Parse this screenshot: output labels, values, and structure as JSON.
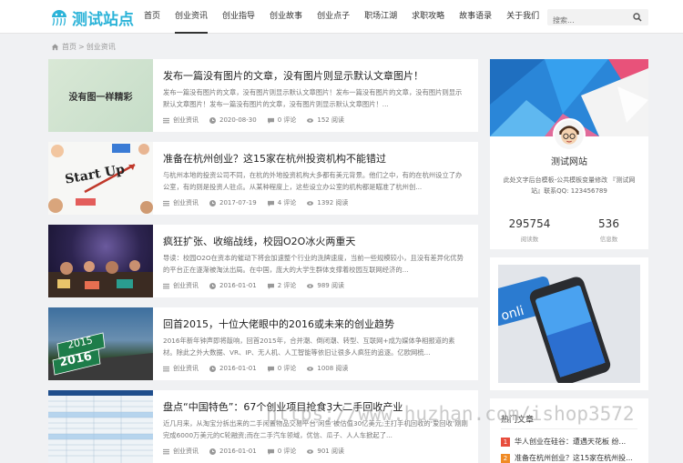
{
  "header": {
    "logo_text": "测试站点",
    "nav": [
      "首页",
      "创业资讯",
      "创业指导",
      "创业故事",
      "创业点子",
      "职场江湖",
      "求职攻略",
      "故事语录",
      "关于我们"
    ],
    "active_nav": "创业资讯",
    "search_placeholder": "搜索..."
  },
  "breadcrumb": {
    "home": "首页",
    "separator": ">",
    "current": "创业资讯"
  },
  "posts": [
    {
      "title": "发布一篇没有图片的文章，没有图片则显示默认文章图片！",
      "excerpt": "发布一篇没有图片的文章，没有图片则显示默认文章图片！发布一篇没有图片的文章，没有图片则显示默认文章图片！发布一篇没有图片的文章，没有图片则显示默认文章图片！...",
      "thumb_text": "没有图一样精彩",
      "category": "创业资讯",
      "date": "2020-08-30",
      "comments": "0 评论",
      "views": "152 阅读"
    },
    {
      "title": "准备在杭州创业？这15家在杭州投资机构不能错过",
      "excerpt": "与杭州本地的投资公司不同，在杭的外地投资机构大多都有美元背景。他们之中，有的在杭州设立了办公室，有的则是投资人驻点。从某种程度上，这些设立办公室的机构都是瞄准了杭州创...",
      "thumb_text": "Start Up",
      "category": "创业资讯",
      "date": "2017-07-19",
      "comments": "4 评论",
      "views": "1392 阅读"
    },
    {
      "title": "疯狂扩张、收缩战线，校园O2O冰火两重天",
      "excerpt": "导读：校园O2O在资本的催动下将会加速整个行业的洗牌速度，当前一些规模较小，且没有差异化优势的平台正在逐渐被淘汰出局。在中国，庞大的大学生群体支撑着校园互联网经济的...",
      "thumb_text": "",
      "category": "创业资讯",
      "date": "2016-01-01",
      "comments": "2 评论",
      "views": "989 阅读"
    },
    {
      "title": "回首2015，十位大佬眼中的2016或未来的创业趋势",
      "excerpt": "2016年新年钟声即将敲响，回首2015年，合并潮、倒闭潮、转型、互联网+成为媒体争相报道的素材。除此之外大数据、VR、IP、无人机、人工智能等依旧让很多人疯狂的追逐。亿欧网梳...",
      "thumb_text": "2016",
      "category": "创业资讯",
      "date": "2016-01-01",
      "comments": "0 评论",
      "views": "1008 阅读"
    },
    {
      "title": "盘点“中国特色”：67个创业项目抢食3大二手回收产业",
      "excerpt": "近几月来，从淘宝分拆出来的二手闲置物品交易平台‘闲鱼’被估值30亿美元;主打手机回收的‘爱回收’刚刚完成6000万美元的C轮融资;而在二手汽车领域，优信、瓜子、人人车掀起了...",
      "thumb_text": "",
      "category": "创业资讯",
      "date": "2016-01-01",
      "comments": "0 评论",
      "views": "901 阅读"
    }
  ],
  "profile": {
    "name": "测试网站",
    "desc": "此处文字后台模板-公共模板变量修改 『测试网站』联系QQ: 123456789",
    "stats": [
      {
        "num": "295754",
        "label": "阅读数"
      },
      {
        "num": "536",
        "label": "信息数"
      }
    ]
  },
  "hot": {
    "title": "热门文章",
    "items": [
      {
        "rank": "1",
        "text": "华人创业在硅谷：遭遇天花板 纷..."
      },
      {
        "rank": "2",
        "text": "准备在杭州创业？这15家在杭州投..."
      }
    ]
  },
  "watermark": "https://www.huzhan.com/ishop3572",
  "colors": {
    "brand": "#2bb3d8",
    "rank1": "#e74c3c",
    "rank2": "#f08a24"
  }
}
